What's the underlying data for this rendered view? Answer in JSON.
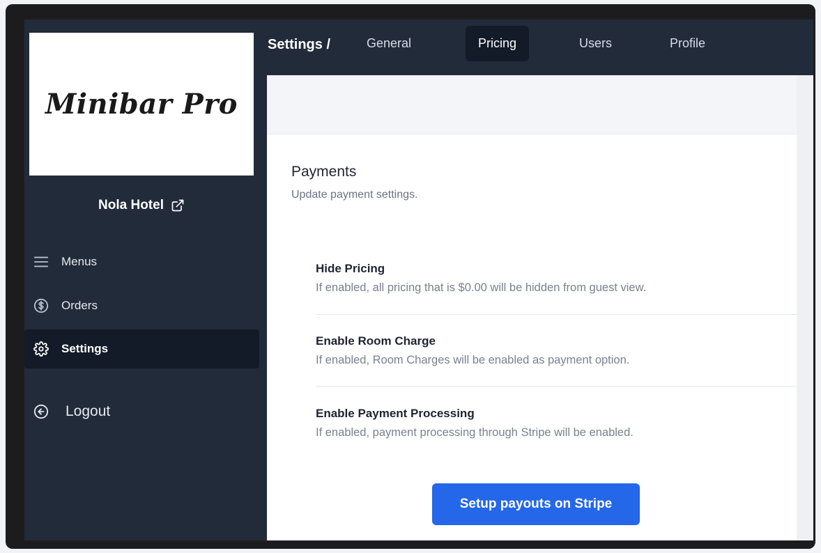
{
  "sidebar": {
    "logo": "Minibar Pro",
    "hotel_name": "Nola Hotel",
    "items": [
      {
        "label": "Menus",
        "icon": "menu-icon"
      },
      {
        "label": "Orders",
        "icon": "dollar-circle-icon"
      },
      {
        "label": "Settings",
        "icon": "gear-icon",
        "active": true
      },
      {
        "label": "Logout",
        "icon": "arrow-left-circle-icon"
      }
    ]
  },
  "header": {
    "breadcrumb": "Settings /",
    "tabs": [
      {
        "label": "General"
      },
      {
        "label": "Pricing",
        "active": true
      },
      {
        "label": "Users"
      },
      {
        "label": "Profile"
      }
    ]
  },
  "payments": {
    "title": "Payments",
    "subtitle": "Update payment settings.",
    "settings": [
      {
        "title": "Hide Pricing",
        "description": "If enabled, all pricing that is $0.00 will be hidden from guest view."
      },
      {
        "title": "Enable Room Charge",
        "description": "If enabled, Room Charges will be enabled as payment option."
      },
      {
        "title": "Enable Payment Processing",
        "description": "If enabled, payment processing through Stripe will be enabled."
      }
    ],
    "stripe_button": "Setup payouts on Stripe"
  },
  "colors": {
    "sidebar_bg": "#222b3a",
    "active_bg": "#131b28",
    "accent": "#2467e9"
  }
}
